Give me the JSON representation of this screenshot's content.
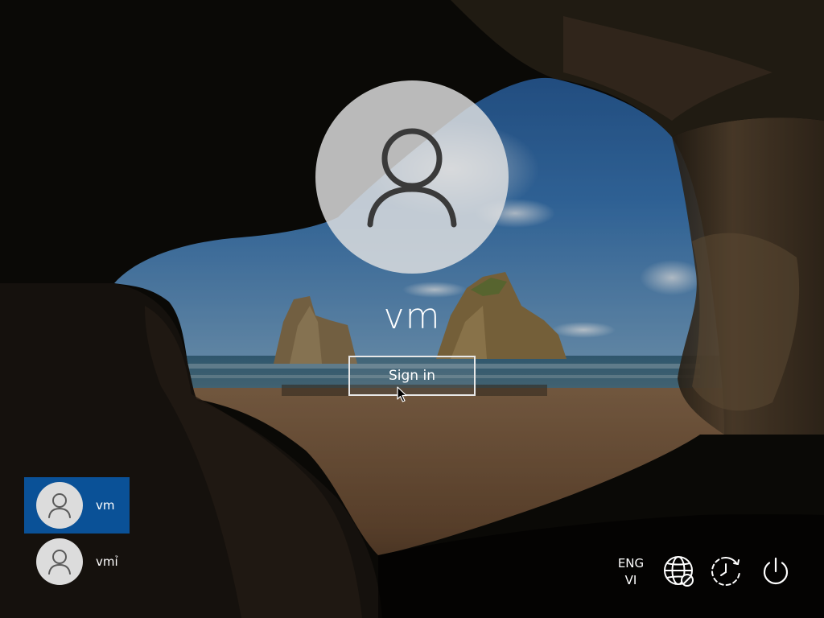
{
  "login": {
    "main_username": "vm",
    "sign_in_label": "Sign in"
  },
  "users": [
    {
      "label": "vm",
      "selected": true
    },
    {
      "label": "vmỉ",
      "selected": false
    }
  ],
  "corner": {
    "lang_primary": "ENG",
    "lang_secondary": "VI",
    "icons": [
      "network-icon",
      "accessibility-icon",
      "power-icon"
    ]
  },
  "colors": {
    "selected_user_bg": "#0a5197",
    "avatar_bg": "#dcdcdc"
  }
}
